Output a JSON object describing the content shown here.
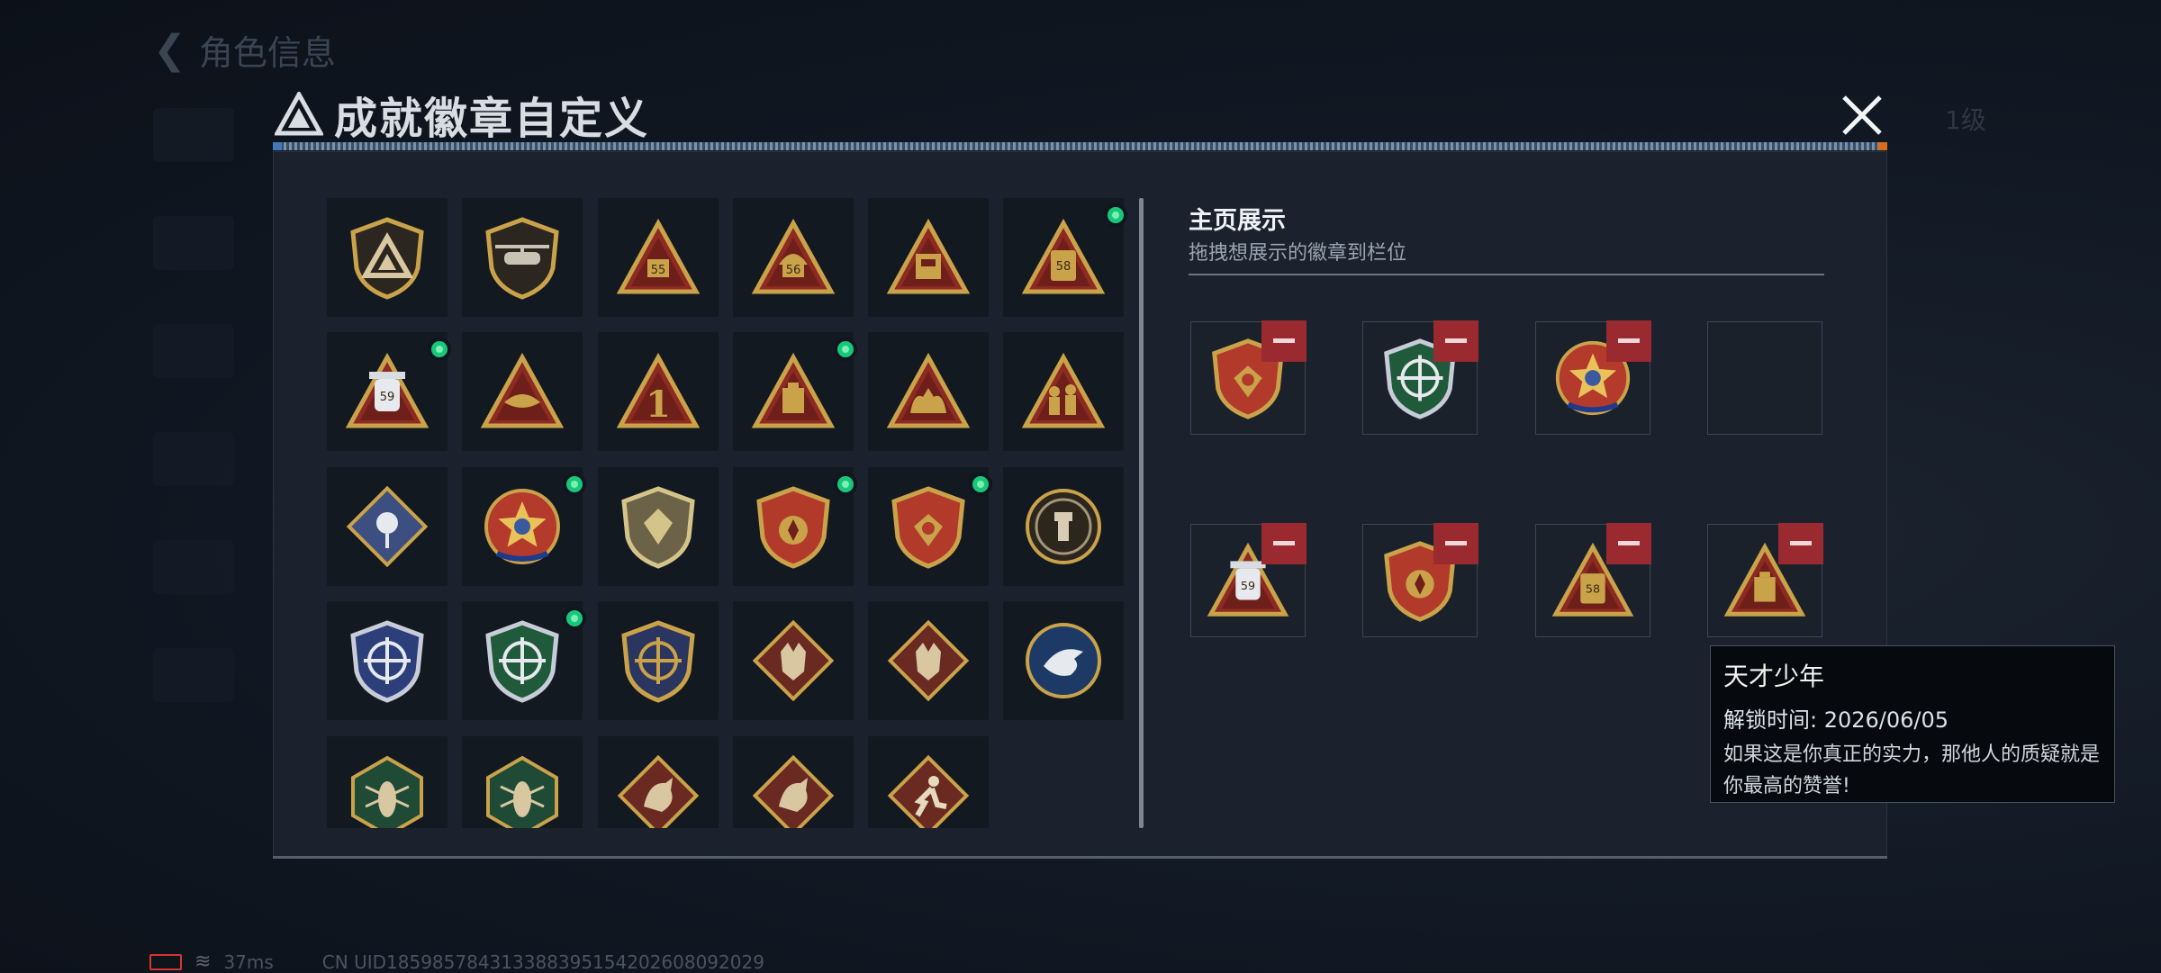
{
  "background": {
    "title": "角色信息",
    "right_tag": "1级"
  },
  "modal": {
    "title": "成就徽章自定义"
  },
  "showcase": {
    "title": "主页展示",
    "subtitle": "拖拽想展示的徽章到栏位",
    "slots": [
      {
        "icon": "shield-eagle-banner-badge",
        "filled": true
      },
      {
        "icon": "green-crosshair-shield-badge",
        "filled": true
      },
      {
        "icon": "red-star-wreath-badge",
        "filled": true
      },
      {
        "icon": "empty-slot",
        "filled": false
      },
      {
        "icon": "syringe-59-triangle-badge",
        "filled": true
      },
      {
        "icon": "blue-banner-gold-shield-badge",
        "filled": true
      },
      {
        "icon": "jerrycan-58-triangle-badge",
        "filled": true
      },
      {
        "icon": "ammo-box-triangle-badge",
        "filled": true
      }
    ]
  },
  "badges": [
    {
      "icon": "triangle-logo-shield-badge",
      "new": false
    },
    {
      "icon": "helicopter-shield-badge",
      "new": false
    },
    {
      "icon": "backpack-55-triangle-badge",
      "new": false
    },
    {
      "icon": "helmet-56-triangle-badge",
      "new": false
    },
    {
      "icon": "box-triangle-badge",
      "new": false
    },
    {
      "icon": "jerrycan-58-triangle-badge",
      "new": true
    },
    {
      "icon": "syringe-59-triangle-badge",
      "new": true
    },
    {
      "icon": "bird-triangle-badge",
      "new": false
    },
    {
      "icon": "number-one-triangle-badge",
      "new": false
    },
    {
      "icon": "ammo-box-triangle-badge",
      "new": true
    },
    {
      "icon": "hands-triangle-badge",
      "new": false
    },
    {
      "icon": "soldiers-triangle-badge",
      "new": false
    },
    {
      "icon": "rose-diamond-badge",
      "new": false
    },
    {
      "icon": "red-star-wreath-badge",
      "new": true
    },
    {
      "icon": "gold-shield-emblem-badge",
      "new": false
    },
    {
      "icon": "blue-banner-gold-shield-badge",
      "new": true
    },
    {
      "icon": "shield-eagle-banner-badge",
      "new": true
    },
    {
      "icon": "soldier-crosshair-circle-badge",
      "new": false
    },
    {
      "icon": "blue-crosshair-shield-badge",
      "new": false
    },
    {
      "icon": "green-crosshair-shield-badge",
      "new": true
    },
    {
      "icon": "gold-crosshair-shield-badge",
      "new": false
    },
    {
      "icon": "wolf-diamond-badge",
      "new": false
    },
    {
      "icon": "wolf-diamond-badge-2",
      "new": false
    },
    {
      "icon": "eagle-circle-badge",
      "new": false
    },
    {
      "icon": "locust-hexagon-badge",
      "new": false
    },
    {
      "icon": "locust-hexagon-badge-2",
      "new": false
    },
    {
      "icon": "dragon-diamond-badge",
      "new": false
    },
    {
      "icon": "dragon-diamond-badge-2",
      "new": false
    },
    {
      "icon": "runner-diamond-badge",
      "new": false
    }
  ],
  "tooltip": {
    "name": "天才少年",
    "unlock_label": "解锁时间: ",
    "unlock_time": "2026/06/05",
    "description": "如果这是你真正的实力，那他人的质疑就是你最高的赞誉!"
  },
  "status_bar": {
    "ping": "37ms",
    "uid": "CN UID1859857843133883951542026080920​29"
  },
  "colors": {
    "new_dot": "#18c77a",
    "remove_button": "#9b2a30",
    "panel": "#1b222d",
    "background": "#0f1520"
  }
}
